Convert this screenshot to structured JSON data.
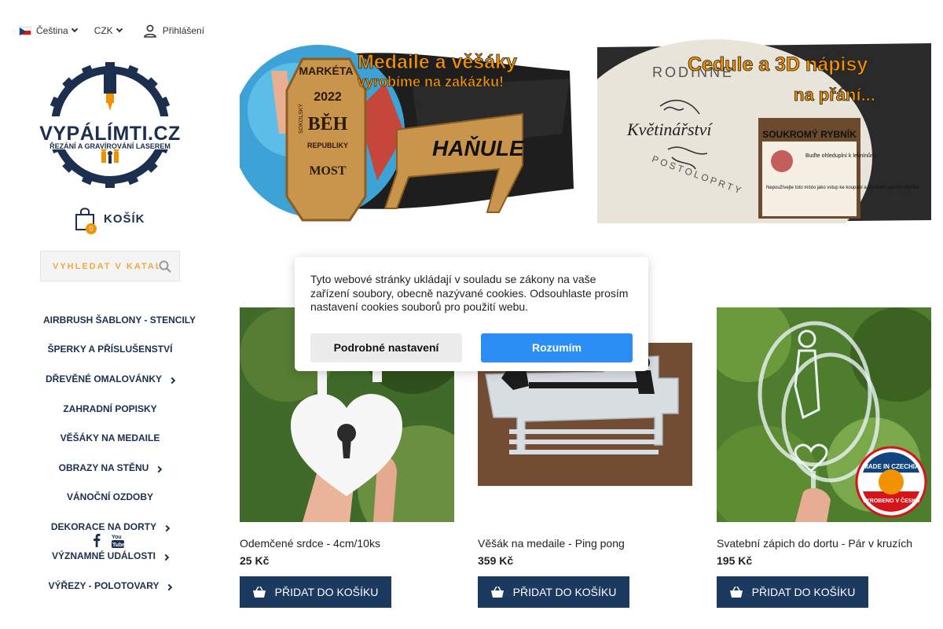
{
  "topbar": {
    "language": "Čeština",
    "currency": "CZK",
    "login": "Přihlášení"
  },
  "logo": {
    "brand": "VYPÁLÍMTI.CZ",
    "tagline": "ŘEZÁNÍ A GRAVÍROVÁNÍ LASEREM"
  },
  "cart": {
    "label": "KOŠÍK",
    "count": "0"
  },
  "search": {
    "placeholder": "VYHLEDAT V KATALOGU"
  },
  "nav": [
    {
      "label": "AIRBRUSH ŠABLONY - STENCILY",
      "has_sub": false
    },
    {
      "label": "ŠPERKY A PŘÍSLUŠENSTVÍ",
      "has_sub": false
    },
    {
      "label": "DŘEVĚNÉ OMALOVÁNKY",
      "has_sub": true
    },
    {
      "label": "ZAHRADNÍ POPISKY",
      "has_sub": false
    },
    {
      "label": "VĚŠÁKY NA MEDAILE",
      "has_sub": false
    },
    {
      "label": "OBRAZY NA STĚNU",
      "has_sub": true
    },
    {
      "label": "VÁNOČNÍ OZDOBY",
      "has_sub": false
    },
    {
      "label": "DEKORACE NA DORTY",
      "has_sub": true
    },
    {
      "label": "VÝZNAMNÉ UDÁLOSTI",
      "has_sub": true
    },
    {
      "label": "VÝŘEZY - POLOTOVARY",
      "has_sub": true
    }
  ],
  "banners": [
    {
      "headline1": "Medaile a věšáky",
      "headline2": "vyrobíme na zakázku!",
      "medal_text": [
        "MARKÉTA",
        "2022",
        "SOKOLSKÝ",
        "BĚH",
        "REPUBLIKY",
        "MOST"
      ],
      "hanger_text": "HAŇULE"
    },
    {
      "headline1": "Cedule a 3D nápisy",
      "headline2": "na přání...",
      "sign_text": [
        "RODINNÉ",
        "Květinářství",
        "POSTOLOPRTY"
      ],
      "board_title": "SOUKROMÝ RYBNÍK",
      "board_text1": "Buďte ohleduplní k leknínům!",
      "board_text2": "Nepoužívejte toto místo jako vstup ke koupání a pouštění psů do rybníka!"
    }
  ],
  "products": [
    {
      "name": "Odemčené srdce - 4cm/10ks",
      "price": "25 Kč",
      "button": "PŘIDAT DO KOŠÍKU"
    },
    {
      "name": "Věšák na medaile - Ping pong",
      "price": "359 Kč",
      "button": "PŘIDAT DO KOŠÍKU"
    },
    {
      "name": "Svatební zápich do dortu - Pár v kruzích",
      "price": "195 Kč",
      "button": "PŘIDAT DO KOŠÍKU",
      "badge": [
        "MADE IN CZECHIA",
        "VYROBENO V ČESKU"
      ]
    }
  ],
  "cookie": {
    "text": "Tyto webové stránky ukládají v souladu se zákony na vaše zařízení soubory, obecně nazývané cookies. Odsouhlaste prosím nastavení cookies souborů pro použití webu.",
    "settings_button": "Podrobné nastavení",
    "accept_button": "Rozumím"
  },
  "colors": {
    "navy": "#1c2f4f",
    "orange": "#f39200",
    "button": "#1c3a60",
    "accept": "#2b8ef5"
  }
}
